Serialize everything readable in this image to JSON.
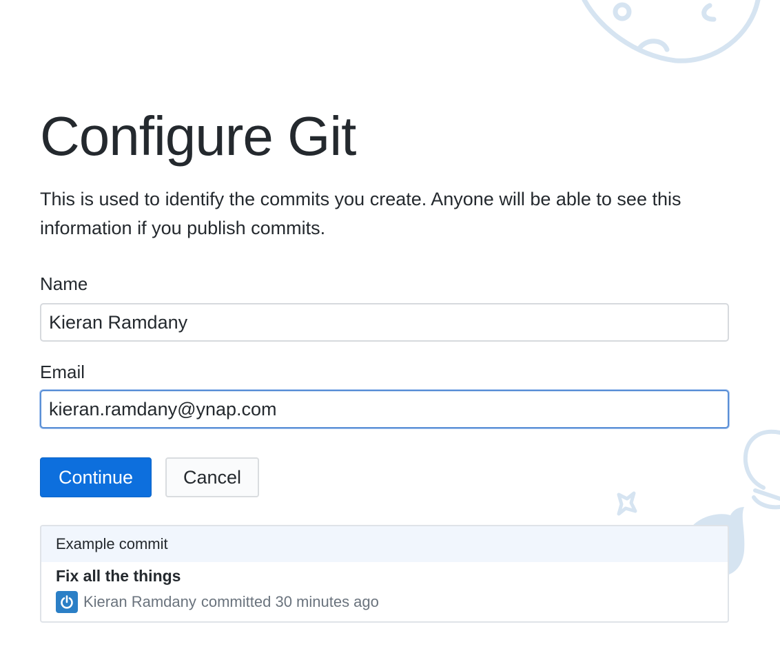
{
  "page": {
    "title": "Configure Git",
    "description": "This is used to identify the commits you create. Anyone will be able to see this information if you publish commits."
  },
  "form": {
    "name_label": "Name",
    "name_value": "Kieran Ramdany",
    "email_label": "Email",
    "email_value": "kieran.ramdany@ynap.com"
  },
  "buttons": {
    "continue_label": "Continue",
    "cancel_label": "Cancel"
  },
  "example_commit": {
    "header": "Example commit",
    "summary": "Fix all the things",
    "author": "Kieran Ramdany",
    "meta_suffix": "committed 30 minutes ago",
    "avatar_icon": "power-icon"
  },
  "colors": {
    "primary": "#0d6fdd",
    "decor": "#d6e4f1"
  }
}
